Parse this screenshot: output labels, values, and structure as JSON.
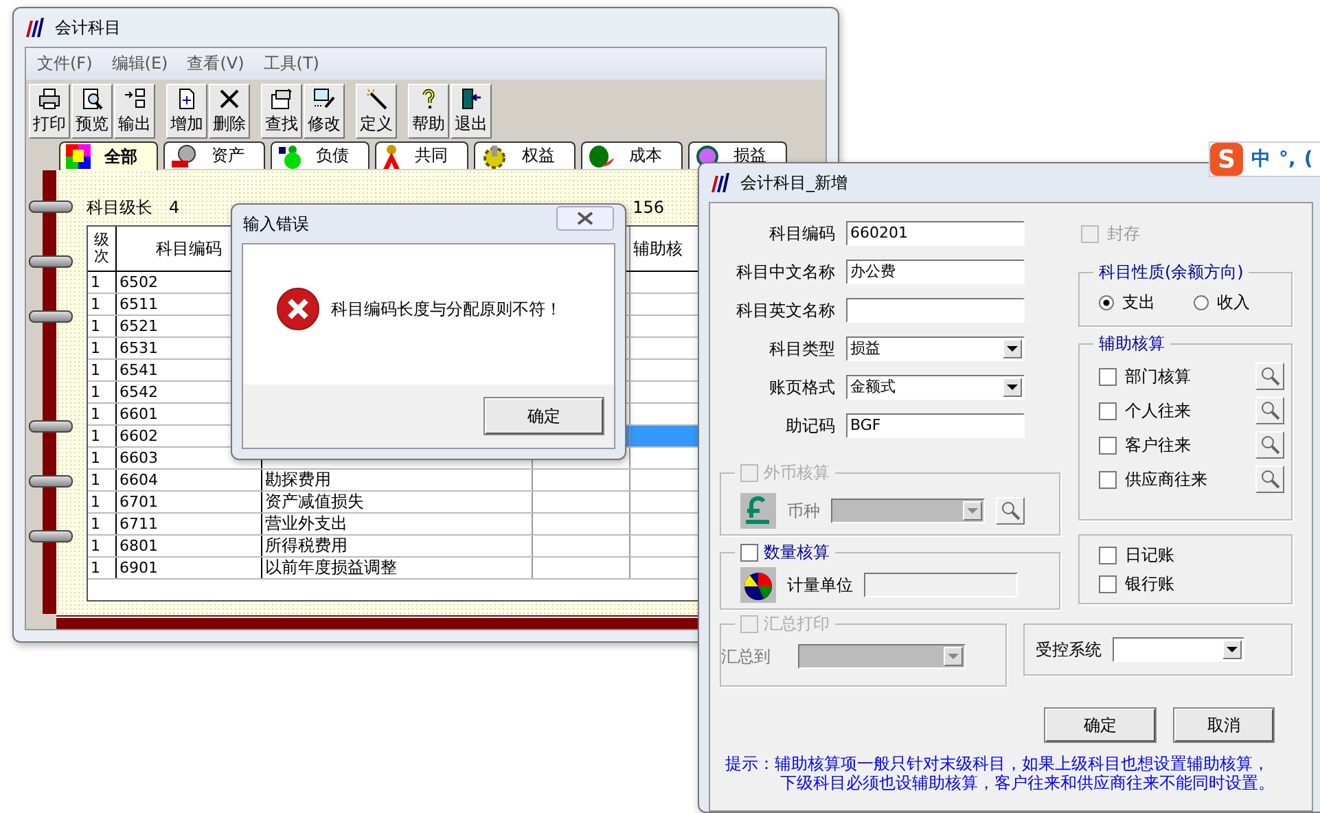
{
  "main_window": {
    "title": "会计科目",
    "menu": [
      "文件(F)",
      "编辑(E)",
      "查看(V)",
      "工具(T)"
    ],
    "toolbar": [
      [
        {
          "label": "打印"
        },
        {
          "label": "预览"
        },
        {
          "label": "输出"
        }
      ],
      [
        {
          "label": "增加"
        },
        {
          "label": "删除"
        }
      ],
      [
        {
          "label": "查找"
        },
        {
          "label": "修改"
        }
      ],
      [
        {
          "label": "定义"
        }
      ],
      [
        {
          "label": "帮助"
        },
        {
          "label": "退出"
        }
      ]
    ],
    "tabs": [
      {
        "label": "全部",
        "selected": true
      },
      {
        "label": "资产",
        "selected": false
      },
      {
        "label": "负债",
        "selected": false
      },
      {
        "label": "共同",
        "selected": false
      },
      {
        "label": "权益",
        "selected": false
      },
      {
        "label": "成本",
        "selected": false
      },
      {
        "label": "损益",
        "selected": false
      }
    ],
    "level_length_label": "科目级长",
    "level_length": "4",
    "count": "156",
    "table": {
      "columns": [
        "级次",
        "科目编码",
        "辅助核"
      ],
      "rows": [
        {
          "level": "1",
          "code": "6502",
          "selected": false
        },
        {
          "level": "1",
          "code": "6511",
          "selected": false
        },
        {
          "level": "1",
          "code": "6521",
          "selected": false
        },
        {
          "level": "1",
          "code": "6531",
          "selected": false
        },
        {
          "level": "1",
          "code": "6541",
          "selected": false
        },
        {
          "level": "1",
          "code": "6542",
          "selected": false
        },
        {
          "level": "1",
          "code": "6601",
          "selected": false
        },
        {
          "level": "1",
          "code": "6602",
          "selected": true
        },
        {
          "level": "1",
          "code": "6603",
          "selected": false
        },
        {
          "level": "1",
          "code": "6604",
          "name": "勘探费用",
          "selected": false
        },
        {
          "level": "1",
          "code": "6701",
          "name": "资产减值损失",
          "selected": false
        },
        {
          "level": "1",
          "code": "6711",
          "name": "营业外支出",
          "selected": false
        },
        {
          "level": "1",
          "code": "6801",
          "name": "所得税费用",
          "selected": false
        },
        {
          "level": "1",
          "code": "6901",
          "name": "以前年度损益调整",
          "selected": false
        }
      ]
    }
  },
  "error_dialog": {
    "title": "输入错误",
    "message": "科目编码长度与分配原则不符！",
    "button": "确定"
  },
  "new_dialog": {
    "title": "会计科目_新增",
    "fields": [
      {
        "label": "科目编码",
        "value": "660201",
        "kind": "text"
      },
      {
        "label": "科目中文名称",
        "value": "办公费",
        "kind": "text"
      },
      {
        "label": "科目英文名称",
        "kind": "text"
      },
      {
        "label": "科目类型",
        "value": "损益",
        "kind": "select"
      },
      {
        "label": "账页格式",
        "value": "金额式",
        "kind": "select"
      },
      {
        "label": "助记码",
        "value": "BGF",
        "kind": "text"
      }
    ],
    "sealed": {
      "label": "封存",
      "checked": false,
      "disabled": true
    },
    "nature": {
      "title": "科目性质(余额方向)",
      "options": [
        {
          "label": "支出",
          "selected": true
        },
        {
          "label": "收入",
          "selected": false
        }
      ]
    },
    "aux": {
      "title": "辅助核算",
      "items": [
        {
          "label": "部门核算",
          "checked": false
        },
        {
          "label": "个人往来",
          "checked": false
        },
        {
          "label": "客户往来",
          "checked": false
        },
        {
          "label": "供应商往来",
          "checked": false
        }
      ]
    },
    "currency": {
      "label": "外币核算",
      "checked": false,
      "disabled": true,
      "field_label": "币种"
    },
    "quantity": {
      "label": "数量核算",
      "checked": false,
      "disabled": false,
      "field_label": "计量单位"
    },
    "journals": [
      {
        "label": "日记账",
        "checked": false
      },
      {
        "label": "银行账",
        "checked": false
      }
    ],
    "summary": {
      "label": "汇总打印",
      "checked": false,
      "disabled": true,
      "field_label": "汇总到"
    },
    "controlled": {
      "label": "受控系统"
    },
    "buttons": [
      "确定",
      "取消"
    ],
    "hint": [
      "提示：辅助核算项一般只针对末级科目，如果上级科目也想设置辅助核算，",
      "下级科目必须也设辅助核算，客户往来和供应商往来不能同时设置。"
    ]
  },
  "ime": {
    "logo": "S",
    "mode": "中",
    "punct": "°,",
    "extra": "("
  }
}
